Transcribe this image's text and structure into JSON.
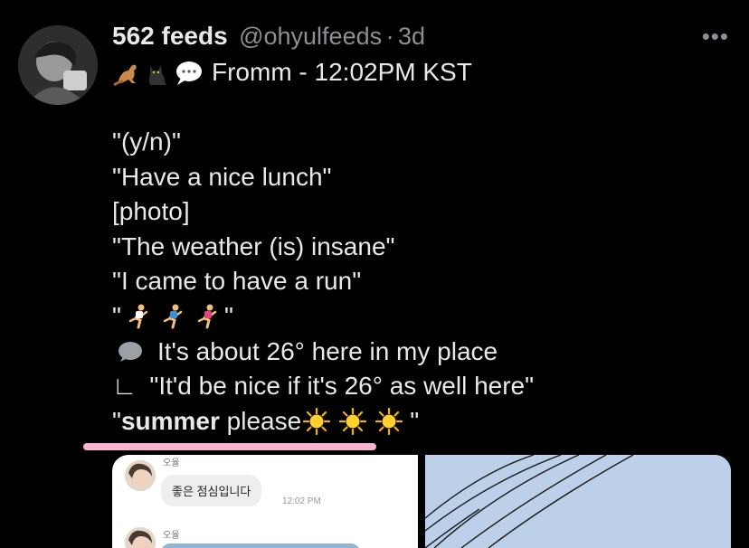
{
  "tweet": {
    "display_name": "562 feeds",
    "handle": "@ohyulfeeds",
    "separator": "·",
    "time": "3d",
    "more_label": "•••",
    "subline_text": "Fromm - 12:02PM KST",
    "subline_emojis": [
      "kangaroo-emoji",
      "black-cat-emoji",
      "speech-bubble-emoji"
    ],
    "lines": [
      "\"(y/n)\"",
      "\"Have a nice lunch\"",
      "[photo]",
      "\"The weather (is) insane\"",
      "\"I came to have a run\""
    ],
    "runner_line": {
      "open_quote": "\"",
      "close_quote": "\"",
      "runner_icons": [
        "runner-icon",
        "runner-icon",
        "runner-icon"
      ]
    },
    "bubble_line_text": "It's about 26° here in my place",
    "reply_line_prefix": "∟",
    "reply_line_text": "\"It'd be nice if it's 26° as well here\"",
    "summer_line": {
      "open_quote": "\"",
      "bold_word": "summer",
      "rest": " please",
      "close_quote": "\"",
      "sun_icons": [
        "sun-icon",
        "sun-icon",
        "sun-icon"
      ]
    }
  },
  "media": {
    "chat": {
      "sender_name_1": "오율",
      "bubble_1": "좋은 점심입니다",
      "time_1": "12:02 PM",
      "sender_name_2": "오율"
    }
  },
  "colors": {
    "background": "#000000",
    "text": "#e7e9ea",
    "secondary_text": "#8b9096",
    "highlight_underline": "#f6b4cf",
    "sky": "#bcd0ea"
  }
}
